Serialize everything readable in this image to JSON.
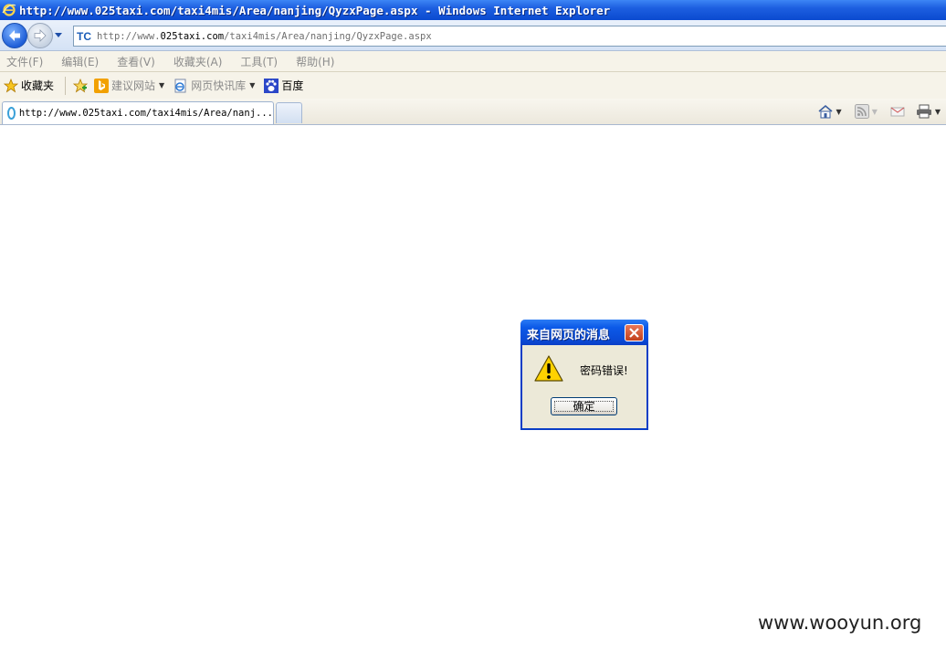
{
  "window": {
    "title": "http://www.025taxi.com/taxi4mis/Area/nanjing/QyzxPage.aspx - Windows Internet Explorer"
  },
  "address_bar": {
    "url_prefix": "http://www.",
    "url_domain": "025taxi.com",
    "url_path": "/taxi4mis/Area/nanjing/QyzxPage.aspx",
    "site_icon": "TC"
  },
  "menu": {
    "items": [
      "文件(F)",
      "编辑(E)",
      "查看(V)",
      "收藏夹(A)",
      "工具(T)",
      "帮助(H)"
    ]
  },
  "favorites_bar": {
    "favorites_label": "收藏夹",
    "suggested_sites": "建议网站",
    "web_slice": "网页快讯库",
    "baidu": "百度"
  },
  "tabs": [
    {
      "label": "http://www.025taxi.com/taxi4mis/Area/nanj..."
    }
  ],
  "dialog": {
    "title": "来自网页的消息",
    "message": "密码错误!",
    "ok_label": "确定"
  },
  "watermark": "www.wooyun.org",
  "colors": {
    "title_bar": "#0a4ad0",
    "dialog_border": "#0a3ec6",
    "dialog_face": "#ece9d8"
  }
}
